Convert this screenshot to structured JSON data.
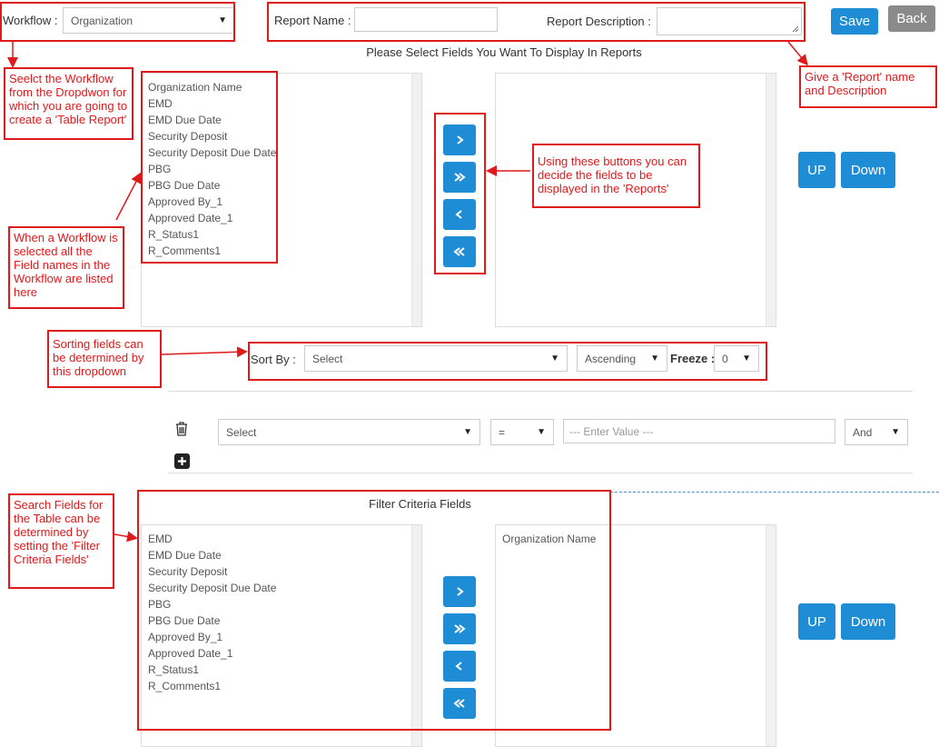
{
  "header": {
    "workflow_label": "Workflow :",
    "workflow_value": "Organization",
    "report_name_label": "Report Name :",
    "report_name_value": "",
    "report_description_label": "Report Description :",
    "report_description_value": "",
    "save_label": "Save",
    "back_label": "Back"
  },
  "display_section": {
    "title": "Please Select Fields You Want To Display In Reports",
    "available_fields": [
      "Organization Name",
      "EMD",
      "EMD Due Date",
      "Security Deposit",
      "Security Deposit Due Date",
      "PBG",
      "PBG Due Date",
      "Approved By_1",
      "Approved Date_1",
      "R_Status1",
      "R_Comments1"
    ],
    "selected_fields": [],
    "up_label": "UP",
    "down_label": "Down"
  },
  "sort": {
    "label": "Sort By :",
    "field_value": "Select",
    "order_value": "Ascending",
    "freeze_label": "Freeze :",
    "freeze_value": "0"
  },
  "filter_row": {
    "field_value": "Select",
    "operator_value": "=",
    "value_placeholder": "--- Enter Value ---",
    "conjunction_value": "And"
  },
  "filter_section": {
    "title": "Filter Criteria Fields",
    "available_fields": [
      "EMD",
      "EMD Due Date",
      "Security Deposit",
      "Security Deposit Due Date",
      "PBG",
      "PBG Due Date",
      "Approved By_1",
      "Approved Date_1",
      "R_Status1",
      "R_Comments1"
    ],
    "selected_fields": [
      "Organization Name"
    ],
    "up_label": "UP",
    "down_label": "Down"
  },
  "annotations": {
    "workflow_note": "Seelct the Workflow from the Dropdwon for which you are going to create a 'Table Report'",
    "report_name_note": "Give a 'Report' name and Description",
    "fields_note": "When a Workflow is selected all the Field names in the Workflow are listed here",
    "buttons_note": "Using these buttons you can decide the fields to be displayed in the 'Reports'",
    "sort_note": "Sorting fields can be determined by this dropdown",
    "filter_note": "Search Fields for the Table can be determined by setting the 'Filter Criteria Fields'"
  },
  "colors": {
    "primary": "#1f8dd6",
    "back_button": "#8a8a8a",
    "annotation": "#e0191b"
  }
}
